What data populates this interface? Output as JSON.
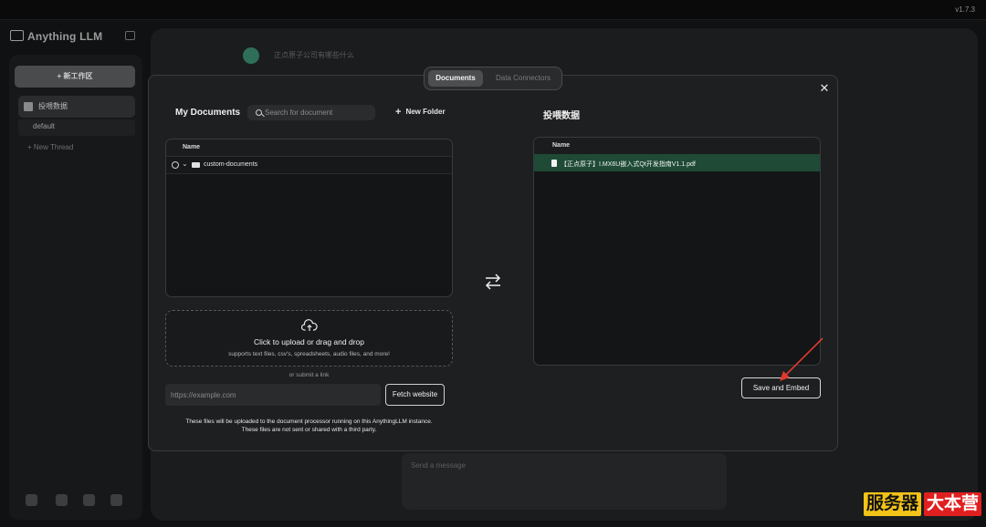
{
  "app": {
    "version": "v1.7.3",
    "brand": "Anything LLM"
  },
  "sidebar": {
    "new_workspace_label": "+ 新工作区",
    "workspace_label": "投喂数据",
    "thread_label": "default",
    "new_thread_label": "+ New Thread"
  },
  "chat": {
    "question_text": "正点原子公司有哪些什么",
    "input_placeholder": "Send a message"
  },
  "modal": {
    "tabs": [
      {
        "label": "Documents",
        "active": true
      },
      {
        "label": "Data Connectors",
        "active": false
      }
    ],
    "my_documents": {
      "title": "My Documents",
      "search_placeholder": "Search for document",
      "new_folder_label": "New Folder",
      "column_name": "Name",
      "items": [
        {
          "type": "folder",
          "name": "custom-documents"
        }
      ]
    },
    "upload": {
      "title": "Click to upload or drag and drop",
      "subtitle": "supports text files, csv's, spreadsheets, audio files, and more!",
      "or_link": "or submit a link",
      "url_placeholder": "https://example.com",
      "fetch_label": "Fetch website"
    },
    "notice_line1": "These files will be uploaded to the document processor running on this AnythingLLM instance.",
    "notice_line2": "These files are not sent or shared with a third party.",
    "workspace": {
      "title": "投喂数据",
      "column_name": "Name",
      "items": [
        {
          "type": "file",
          "name": "【正点原子】I.MX6U嵌入式Qt开发指南V1.1.pdf"
        }
      ],
      "save_label": "Save and Embed"
    }
  },
  "watermark": {
    "part1": "服务器",
    "part2": "大本营"
  },
  "colors": {
    "accent_row": "#1e4a36",
    "annotation_arrow": "#e03a2f"
  }
}
